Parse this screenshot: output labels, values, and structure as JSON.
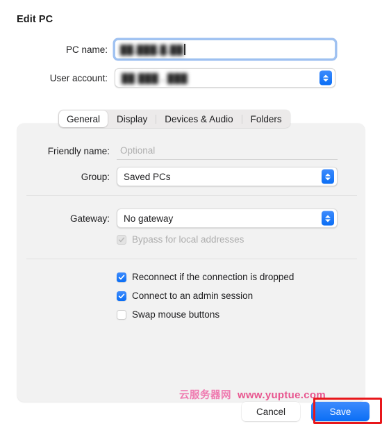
{
  "dialog": {
    "title": "Edit PC"
  },
  "top_form": {
    "pc_name": {
      "label": "PC name:",
      "value": "██.███.█.██",
      "redacted": true,
      "focused": true
    },
    "user_account": {
      "label": "User account:",
      "value": "██  ███ . ███",
      "redacted": true
    }
  },
  "tabs": [
    {
      "label": "General",
      "selected": true
    },
    {
      "label": "Display",
      "selected": false
    },
    {
      "label": "Devices & Audio",
      "selected": false
    },
    {
      "label": "Folders",
      "selected": false
    }
  ],
  "general_tab": {
    "friendly_name": {
      "label": "Friendly name:",
      "value": "",
      "placeholder": "Optional"
    },
    "group": {
      "label": "Group:",
      "value": "Saved PCs"
    },
    "gateway": {
      "label": "Gateway:",
      "value": "No gateway"
    },
    "bypass": {
      "label": "Bypass for local addresses",
      "checked": true,
      "disabled": true
    },
    "options": [
      {
        "label": "Reconnect if the connection is dropped",
        "checked": true
      },
      {
        "label": "Connect to an admin session",
        "checked": true
      },
      {
        "label": "Swap mouse buttons",
        "checked": false
      }
    ]
  },
  "footer": {
    "cancel_label": "Cancel",
    "save_label": "Save"
  },
  "watermark": {
    "brand": "云服务器网",
    "url": "www.yuptue.com"
  },
  "colors": {
    "accent_blue": "#0a6ef5",
    "panel_bg": "#f2f2f2",
    "highlight_red": "#e8171b",
    "watermark_pink": "#ef7ab0"
  }
}
